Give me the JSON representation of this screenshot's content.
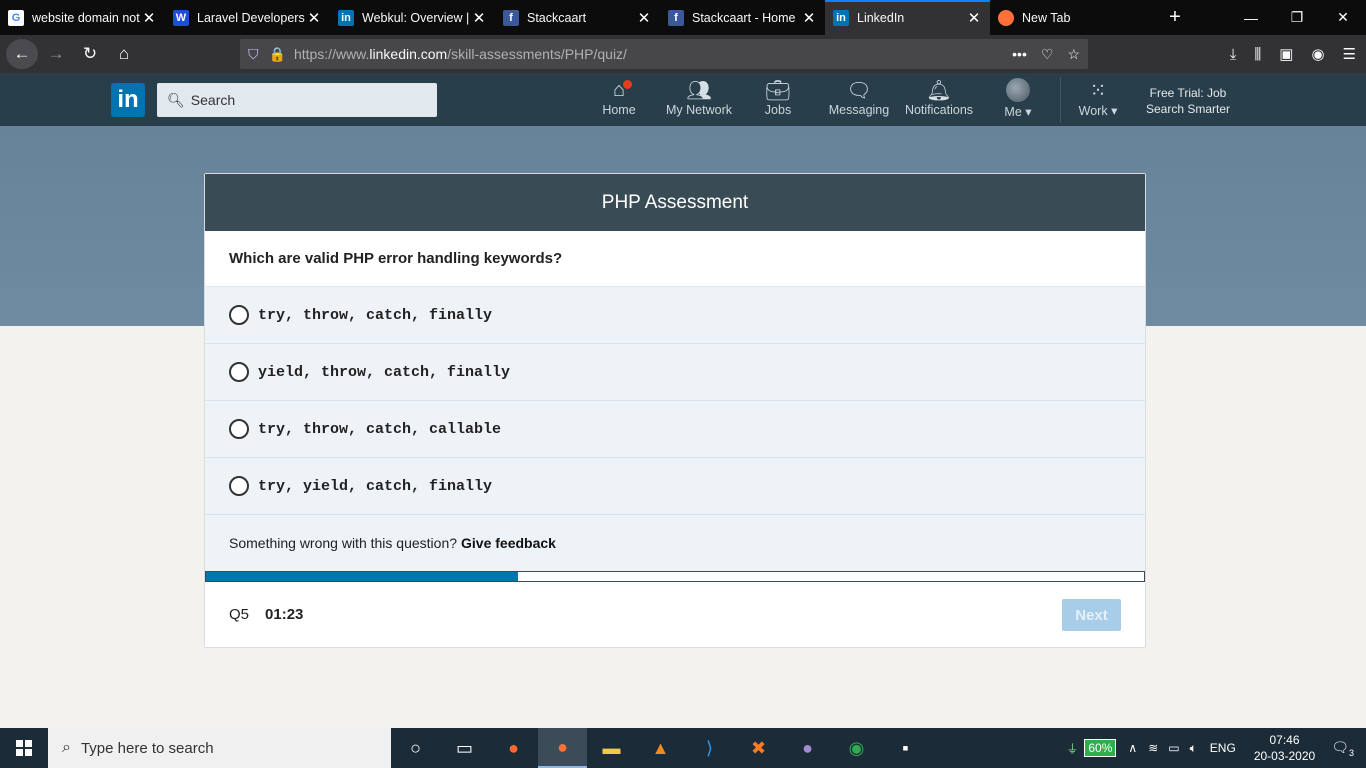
{
  "browser": {
    "tabs": [
      {
        "title": "website domain not",
        "icon": "google-icon",
        "color": "#ffffff",
        "glyph": "G"
      },
      {
        "title": "Laravel Developers",
        "icon": "w-logo-icon",
        "color": "#1d4ed8",
        "glyph": "W"
      },
      {
        "title": "Webkul: Overview |",
        "icon": "linkedin-icon",
        "color": "#0073b1",
        "glyph": "in"
      },
      {
        "title": "Stackcaart",
        "icon": "facebook-icon",
        "color": "#3b5998",
        "glyph": "f"
      },
      {
        "title": "Stackcaart - Home",
        "icon": "facebook-icon",
        "color": "#3b5998",
        "glyph": "f"
      },
      {
        "title": "LinkedIn",
        "icon": "linkedin-icon",
        "color": "#0073b1",
        "glyph": "in"
      },
      {
        "title": "New Tab",
        "icon": "firefox-icon",
        "color": "#ff7139",
        "glyph": "●"
      }
    ],
    "active_tab": 5,
    "url_prefix": "https://www.",
    "url_domain": "linkedin.com",
    "url_path": "/skill-assessments/PHP/quiz/"
  },
  "linkedin": {
    "logo": "in",
    "search_placeholder": "Search",
    "nav": {
      "home": "Home",
      "network": "My Network",
      "jobs": "Jobs",
      "messaging": "Messaging",
      "notifications": "Notifications",
      "me": "Me",
      "work": "Work"
    },
    "trial_line1": "Free Trial: Job",
    "trial_line2": "Search Smarter"
  },
  "quiz": {
    "title": "PHP Assessment",
    "question": "Which are valid PHP error handling keywords?",
    "options": [
      "try, throw, catch, finally",
      "yield, throw, catch, finally",
      "try, throw, catch, callable",
      "try, yield, catch, finally"
    ],
    "feedback_text": "Something wrong with this question?",
    "feedback_link": "Give feedback",
    "progress_fraction": 0.333,
    "question_number": "Q5",
    "timer": "01:23",
    "next_label": "Next"
  },
  "taskbar": {
    "search_placeholder": "Type here to search",
    "battery": "60%",
    "language": "ENG",
    "time": "07:46",
    "date": "20-03-2020",
    "notifications_count": "3"
  }
}
